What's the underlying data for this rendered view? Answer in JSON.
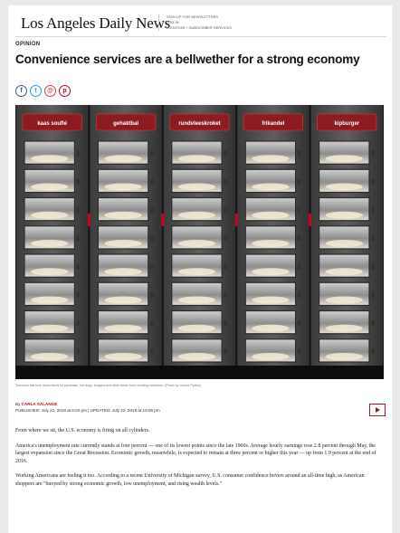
{
  "masthead": {
    "logo": "Los Angeles Daily News",
    "menu": [
      "SIGN UP FOR NEWSLETTERS",
      "LOG IN",
      "E-EDITION + SUBSCRIBER SERVICES"
    ]
  },
  "section": "OPINION",
  "headline": "Convenience services are a bellwether for a strong economy",
  "share": {
    "icons": [
      "facebook-icon",
      "twitter-icon",
      "email-icon",
      "pinterest-icon"
    ],
    "glyphs": [
      "f",
      "t",
      "@",
      "p"
    ],
    "colors": [
      "#3b5998",
      "#1da1f2",
      "#d44638",
      "#bd081c"
    ]
  },
  "photo": {
    "columns": [
      "kaas souflé",
      "gehaktbal",
      "rundvleeskroket",
      "frikandel",
      "kipburger"
    ],
    "header_color": "#8e1b1f"
  },
  "caption": "Travelers last look down items for purchase, hot dogs, burgers and other items from vending machines. (Photo by Leonid Pyakin)",
  "byline": {
    "by": "By ",
    "author": "CARLA SALANGE",
    "published": "PUBLISHED: July 22, 2018 at 6:00 pm | UPDATED: July 22, 2018 at 10:06 pm"
  },
  "paragraphs": [
    "From where we sit, the U.S. economy is firing on all cylinders.",
    "America's unemployment rate currently stands at four percent — one of its lowest points since the late 1960s. Average hourly earnings rose 2.8 percent through May, the largest expansion since the Great Recession. Economic growth, meanwhile, is expected to remain at three percent or higher this year — up from 1.9 percent at the end of 2016.",
    "Working Americans are feeling it too. According to a recent University of Michigan survey, U.S. consumer confidence hovers around an all-time high, as American shoppers are \"buoyed by strong economic growth, low unemployment, and rising wealth levels.\""
  ]
}
